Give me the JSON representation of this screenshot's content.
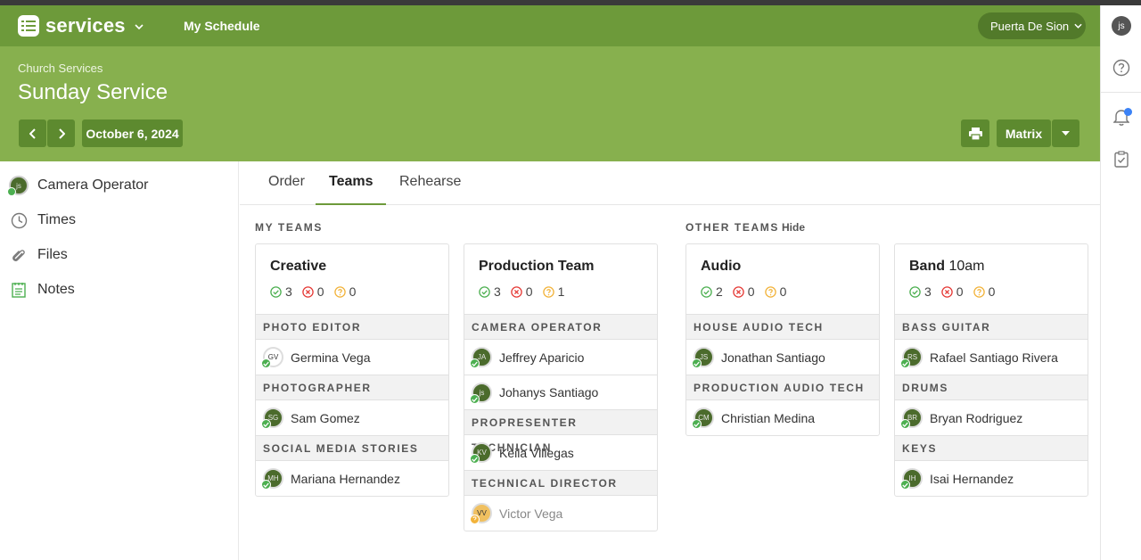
{
  "app": {
    "name": "services",
    "nav_link": "My Schedule",
    "org": "Puerta De Sion",
    "user_initials": "js"
  },
  "plan": {
    "breadcrumb": "Church Services",
    "title": "Sunday Service",
    "date": "October 6, 2024",
    "view_label": "Matrix"
  },
  "leftnav": {
    "items": [
      {
        "label": "Camera Operator",
        "icon": "user-avatar-icon"
      },
      {
        "label": "Times",
        "icon": "clock-icon"
      },
      {
        "label": "Files",
        "icon": "paperclip-icon"
      },
      {
        "label": "Notes",
        "icon": "notes-icon"
      }
    ],
    "avatar_initials": "js"
  },
  "tabs": [
    {
      "label": "Order",
      "active": false
    },
    {
      "label": "Teams",
      "active": true
    },
    {
      "label": "Rehearse",
      "active": false
    }
  ],
  "sections": {
    "my_teams": "MY TEAMS",
    "other_teams": "OTHER TEAMS",
    "hide_label": "Hide"
  },
  "cards": [
    {
      "title": "Creative",
      "time": "",
      "confirmed": "3",
      "declined": "0",
      "pending": "0",
      "positions": [
        {
          "name": "PHOTO EDITOR",
          "people": [
            {
              "name": "Germina Vega",
              "initials": "GV",
              "status": "confirmed",
              "muted": false
            }
          ]
        },
        {
          "name": "PHOTOGRAPHER",
          "people": [
            {
              "name": "Sam Gomez",
              "initials": "SG",
              "status": "confirmed",
              "muted": false
            }
          ]
        },
        {
          "name": "SOCIAL MEDIA STORIES",
          "people": [
            {
              "name": "Mariana Hernandez",
              "initials": "MH",
              "status": "confirmed",
              "muted": false
            }
          ]
        }
      ]
    },
    {
      "title": "Production Team",
      "time": "",
      "confirmed": "3",
      "declined": "0",
      "pending": "1",
      "positions": [
        {
          "name": "CAMERA OPERATOR",
          "people": [
            {
              "name": "Jeffrey Aparicio",
              "initials": "JA",
              "status": "confirmed",
              "muted": false
            },
            {
              "name": "Johanys Santiago",
              "initials": "js",
              "status": "confirmed",
              "muted": false
            }
          ]
        },
        {
          "name": "PROPRESENTER TECHNICIAN",
          "people": [
            {
              "name": "Keila Villegas",
              "initials": "KV",
              "status": "confirmed",
              "muted": false
            }
          ]
        },
        {
          "name": "TECHNICAL DIRECTOR",
          "people": [
            {
              "name": "Victor Vega",
              "initials": "VV",
              "status": "pending",
              "muted": true
            }
          ]
        }
      ]
    },
    {
      "title": "Audio",
      "time": "",
      "confirmed": "2",
      "declined": "0",
      "pending": "0",
      "positions": [
        {
          "name": "HOUSE AUDIO TECH",
          "people": [
            {
              "name": "Jonathan Santiago",
              "initials": "JS",
              "status": "confirmed",
              "muted": false
            }
          ]
        },
        {
          "name": "PRODUCTION AUDIO TECH",
          "people": [
            {
              "name": "Christian Medina",
              "initials": "CM",
              "status": "confirmed",
              "muted": false
            }
          ]
        }
      ]
    },
    {
      "title": "Band",
      "time": "10am",
      "confirmed": "3",
      "declined": "0",
      "pending": "0",
      "positions": [
        {
          "name": "BASS GUITAR",
          "people": [
            {
              "name": "Rafael Santiago Rivera",
              "initials": "RS",
              "status": "confirmed",
              "muted": false
            }
          ]
        },
        {
          "name": "DRUMS",
          "people": [
            {
              "name": "Bryan Rodriguez",
              "initials": "BR",
              "status": "confirmed",
              "muted": false
            }
          ]
        },
        {
          "name": "KEYS",
          "people": [
            {
              "name": "Isai Hernandez",
              "initials": "IH",
              "status": "confirmed",
              "muted": false
            }
          ]
        }
      ]
    }
  ],
  "colors": {
    "navbar": "#6d9a3a",
    "header": "#87b04e",
    "confirmed": "#4caf50",
    "declined": "#e53935",
    "pending": "#f2b33a"
  }
}
